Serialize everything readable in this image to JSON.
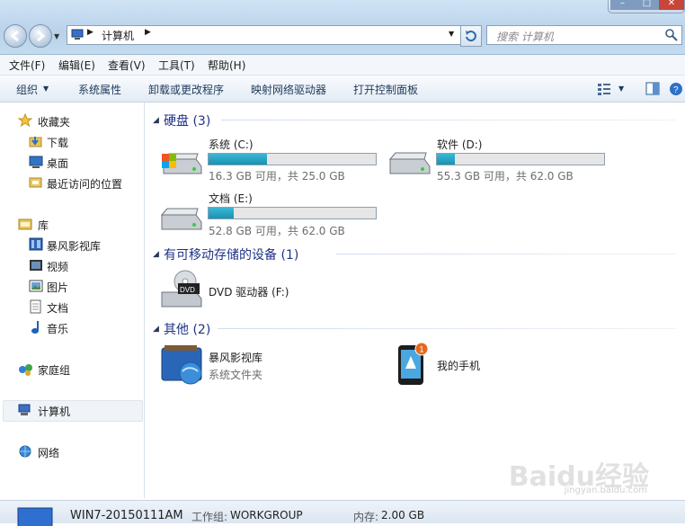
{
  "address": {
    "path": "计算机"
  },
  "search": {
    "placeholder": "搜索 计算机"
  },
  "menu": [
    "文件(F)",
    "编辑(E)",
    "查看(V)",
    "工具(T)",
    "帮助(H)"
  ],
  "commands": [
    "组织",
    "系统属性",
    "卸载或更改程序",
    "映射网络驱动器",
    "打开控制面板"
  ],
  "nav": {
    "favorites": "收藏夹",
    "downloads": "下载",
    "desktop": "桌面",
    "recent": "最近访问的位置",
    "libraries": "库",
    "storm": "暴风影视库",
    "videos": "视频",
    "pictures": "图片",
    "documents": "文档",
    "music": "音乐",
    "homegroup": "家庭组",
    "computer": "计算机",
    "network": "网络"
  },
  "groups": {
    "disks": "硬盘 (3)",
    "removable": "有可移动存储的设备 (1)",
    "other": "其他 (2)"
  },
  "drives": [
    {
      "name": "系统 (C:)",
      "free": "16.3 GB 可用，共 25.0 GB",
      "used_fraction": 0.35
    },
    {
      "name": "软件 (D:)",
      "free": "55.3 GB 可用，共 62.0 GB",
      "used_fraction": 0.11
    },
    {
      "name": "文档 (E:)",
      "free": "52.8 GB 可用，共 62.0 GB",
      "used_fraction": 0.15
    }
  ],
  "dvd": {
    "name": "DVD 驱动器 (F:)",
    "badge": "DVD"
  },
  "other_items": {
    "storm_name": "暴风影视库",
    "storm_sub": "系统文件夹",
    "phone_name": "我的手机",
    "phone_badge": "1"
  },
  "status": {
    "computer": "WIN7-20150111AM",
    "workgroup_label": "工作组:",
    "workgroup": "WORKGROUP",
    "memory_label": "内存:",
    "memory": "2.00 GB"
  },
  "watermark": {
    "main": "Baidu经验",
    "sub": "jingyan.baidu.com"
  },
  "colors": {
    "accent": "#1e3287",
    "bar_fill": "#26a7c7"
  }
}
